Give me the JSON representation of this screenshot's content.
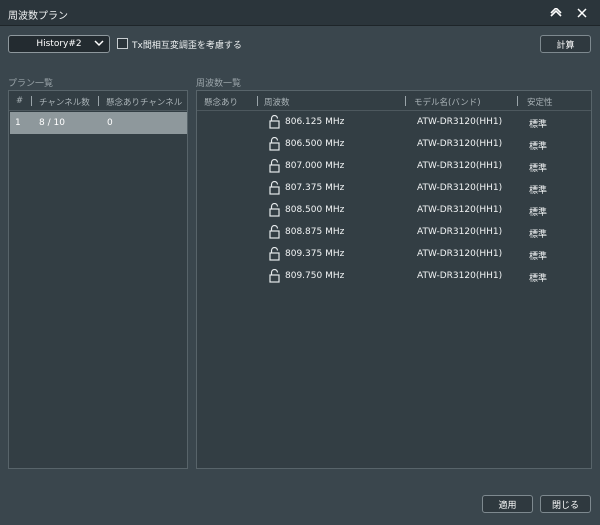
{
  "window": {
    "title": "周波数プラン"
  },
  "toolbar": {
    "history_selected": "History#2",
    "tx_checkbox_label": "Tx間相互変調歪を考慮する",
    "calc_label": "計算"
  },
  "plan_list": {
    "label": "プラン一覧",
    "columns": [
      "#",
      "チャンネル数",
      "懸念ありチャンネル"
    ],
    "rows": [
      {
        "index": "1",
        "channels": "8 / 10",
        "concern": "0"
      }
    ]
  },
  "freq_list": {
    "label": "周波数一覧",
    "columns": [
      "懸念あり",
      "周波数",
      "モデル名(バンド)",
      "安定性"
    ],
    "rows": [
      {
        "freq": "806.125 MHz",
        "model": "ATW-DR3120(HH1)",
        "stability": "標準"
      },
      {
        "freq": "806.500 MHz",
        "model": "ATW-DR3120(HH1)",
        "stability": "標準"
      },
      {
        "freq": "807.000 MHz",
        "model": "ATW-DR3120(HH1)",
        "stability": "標準"
      },
      {
        "freq": "807.375 MHz",
        "model": "ATW-DR3120(HH1)",
        "stability": "標準"
      },
      {
        "freq": "808.500 MHz",
        "model": "ATW-DR3120(HH1)",
        "stability": "標準"
      },
      {
        "freq": "808.875 MHz",
        "model": "ATW-DR3120(HH1)",
        "stability": "標準"
      },
      {
        "freq": "809.375 MHz",
        "model": "ATW-DR3120(HH1)",
        "stability": "標準"
      },
      {
        "freq": "809.750 MHz",
        "model": "ATW-DR3120(HH1)",
        "stability": "標準"
      }
    ]
  },
  "footer": {
    "apply_label": "適用",
    "close_label": "閉じる"
  },
  "icons": {
    "collapse": "chevron-up-icon",
    "close": "close-icon",
    "dropdown": "chevron-down-icon",
    "lock": "unlocked-padlock-icon"
  },
  "colors": {
    "background": "#3a464d",
    "titlebar": "#2b353b",
    "panel": "#333e44",
    "selected_row": "#8e989c"
  }
}
